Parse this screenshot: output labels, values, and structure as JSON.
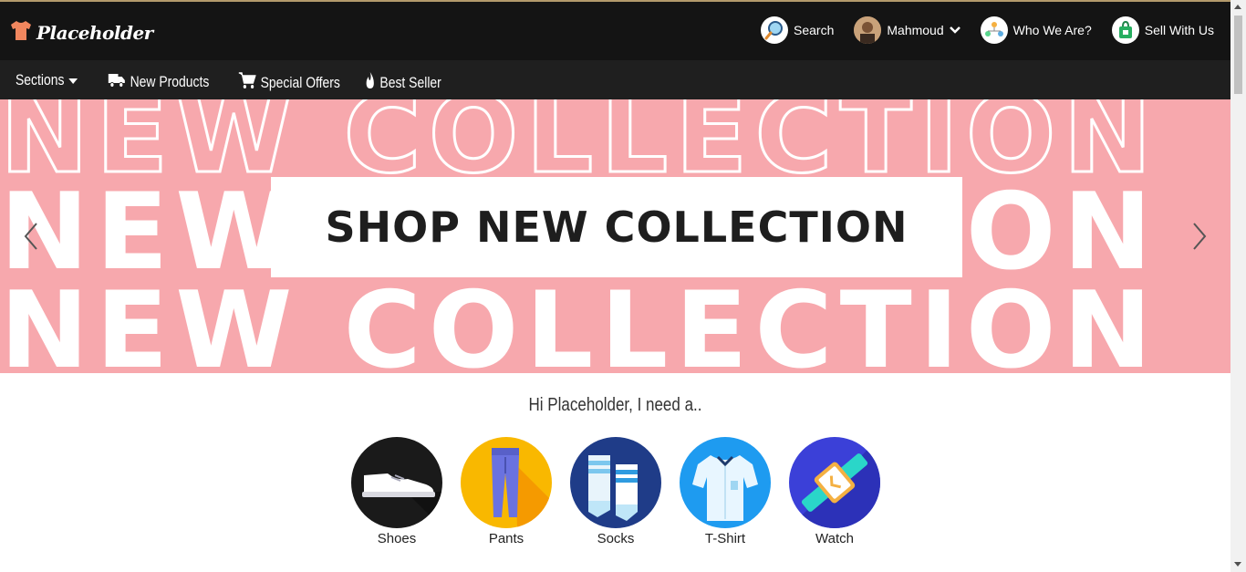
{
  "header": {
    "logo_text": "Placeholder",
    "nav": [
      {
        "label": "Search",
        "icon": "search-icon"
      },
      {
        "label": "Mahmoud",
        "icon": "avatar"
      },
      {
        "label": "Who We Are?",
        "icon": "team-icon"
      },
      {
        "label": "Sell With Us",
        "icon": "shopping-bag-icon"
      }
    ]
  },
  "subnav": {
    "sections": "Sections",
    "new_products": "New Products",
    "special_offers": "Special Offers",
    "best_seller": "Best Seller"
  },
  "banner": {
    "title": "SHOP NEW COLLECTION",
    "bg_word": "NEW COLLECTION"
  },
  "main": {
    "greeting": "Hi Placeholder, I need a..",
    "categories": [
      {
        "label": "Shoes",
        "color": "#1a1a1a"
      },
      {
        "label": "Pants",
        "color": "#f9b800"
      },
      {
        "label": "Socks",
        "color": "#1f3c88"
      },
      {
        "label": "T-Shirt",
        "color": "#1e9bf0"
      },
      {
        "label": "Watch",
        "color": "#3b40d8"
      }
    ]
  },
  "colors": {
    "topbar": "#141414",
    "subnav": "#1f1f1f",
    "banner_bg": "#f7a8ad"
  }
}
